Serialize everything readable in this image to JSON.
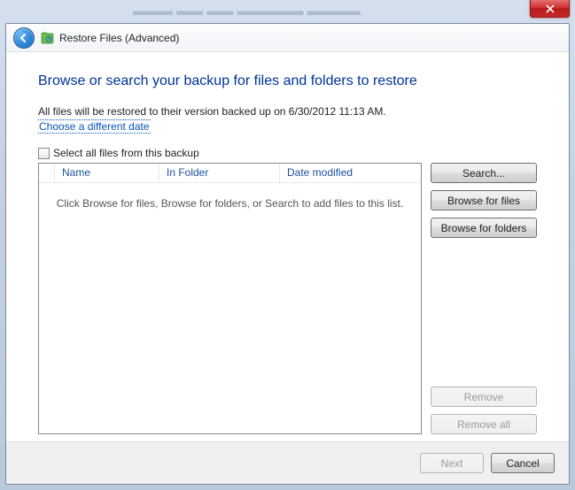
{
  "titlebar": {
    "close_tooltip": "Close"
  },
  "nav": {
    "title": "Restore Files (Advanced)"
  },
  "content": {
    "heading": "Browse or search your backup for files and folders to restore",
    "desc": "All files will be restored to their version backed up on 6/30/2012 11:13 AM.",
    "choose_date_link": "Choose a different date",
    "select_all_label": "Select all files from this backup",
    "columns": {
      "name": "Name",
      "folder": "In Folder",
      "date": "Date modified"
    },
    "empty_msg": "Click Browse for files, Browse for folders, or Search to add files to this list."
  },
  "buttons": {
    "search": "Search...",
    "browse_files": "Browse for files",
    "browse_folders": "Browse for folders",
    "remove": "Remove",
    "remove_all": "Remove all",
    "next": "Next",
    "cancel": "Cancel"
  }
}
